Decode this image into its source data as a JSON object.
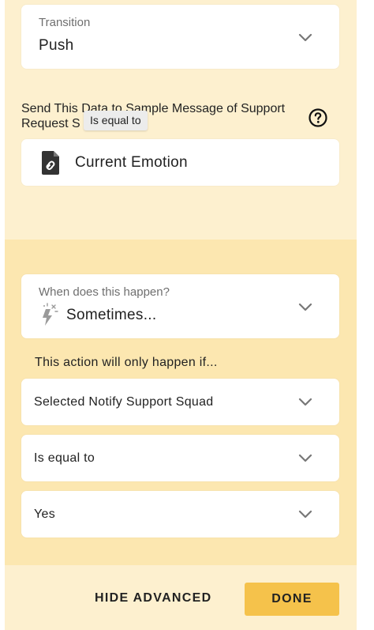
{
  "transition": {
    "label": "Transition",
    "value": "Push"
  },
  "send_data": {
    "text": "Send This Data to Sample Message of Support Request S",
    "tooltip": "Is equal to",
    "field_value": "Current Emotion",
    "field_icon": "linked-file-icon",
    "help_icon": "question-circle-icon"
  },
  "condition": {
    "label": "When does this happen?",
    "value": "Sometimes...",
    "icon": "magic-lightning-icon",
    "intro": "This action will only happen if...",
    "rows": [
      {
        "value": "Selected Notify Support Squad"
      },
      {
        "value": "Is equal to"
      },
      {
        "value": "Yes"
      }
    ]
  },
  "footer": {
    "hide_advanced_label": "HIDE ADVANCED",
    "done_label": "DONE"
  },
  "colors": {
    "panel_light": "#fdf0cf",
    "panel_dark": "#fce7b0",
    "done_button": "#f5c24b"
  }
}
